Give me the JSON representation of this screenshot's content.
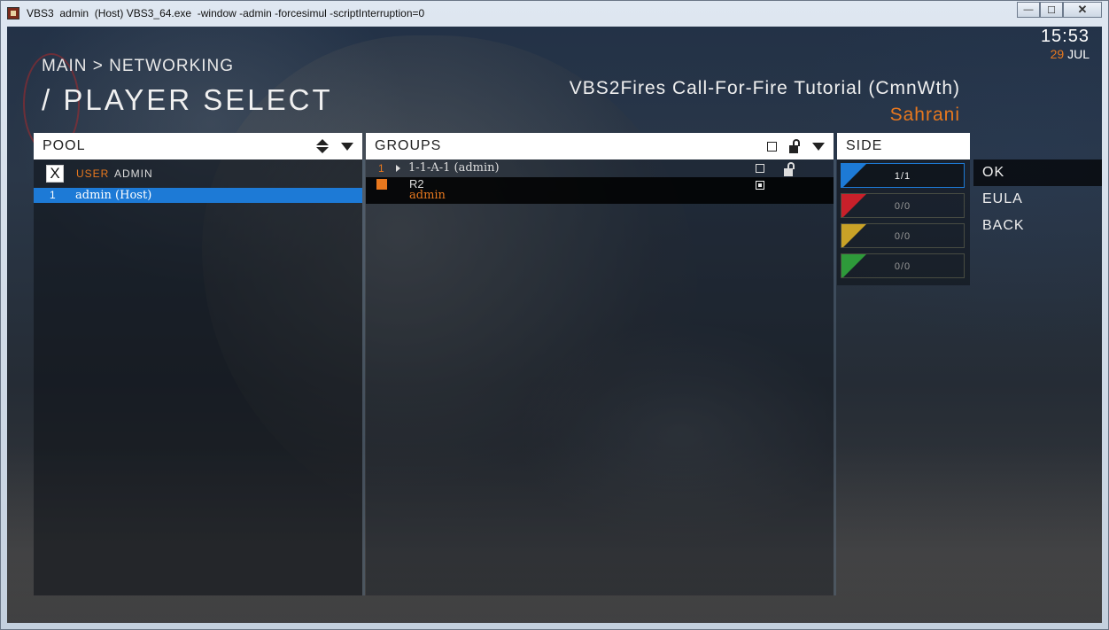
{
  "window": {
    "title": "VBS3  admin  (Host) VBS3_64.exe  -window -admin -forcesimul -scriptInterruption=0",
    "min_label": "—",
    "max_label": "☐",
    "close_label": "✕"
  },
  "clock": {
    "time": "15:53",
    "day": "29",
    "month": "JUL"
  },
  "breadcrumb": "MAIN > NETWORKING",
  "page_title": "/ PLAYER SELECT",
  "mission": {
    "title": "VBS2Fires Call-For-Fire Tutorial (CmnWth)",
    "map": "Sahrani"
  },
  "pool": {
    "header": "POOL",
    "x_label": "X",
    "user_label": "USER",
    "admin_label": "ADMIN",
    "rows": [
      {
        "num": "1",
        "name": "admin (Host)"
      }
    ]
  },
  "groups": {
    "header": "GROUPS",
    "rows": [
      {
        "num": "1",
        "name": "1-1-A-1 (admin)",
        "role": "R2",
        "player": "admin"
      }
    ]
  },
  "side": {
    "header": "SIDE",
    "slots": [
      {
        "value": "1/1",
        "color": "#1d7ad6"
      },
      {
        "value": "0/0",
        "color": "#c8202a"
      },
      {
        "value": "0/0",
        "color": "#c9a227"
      },
      {
        "value": "0/0",
        "color": "#2e9a3a"
      }
    ]
  },
  "menu": {
    "ok": "OK",
    "eula": "EULA",
    "back": "BACK"
  },
  "colors": {
    "accent": "#e8781e",
    "selection": "#1d7ad6"
  }
}
